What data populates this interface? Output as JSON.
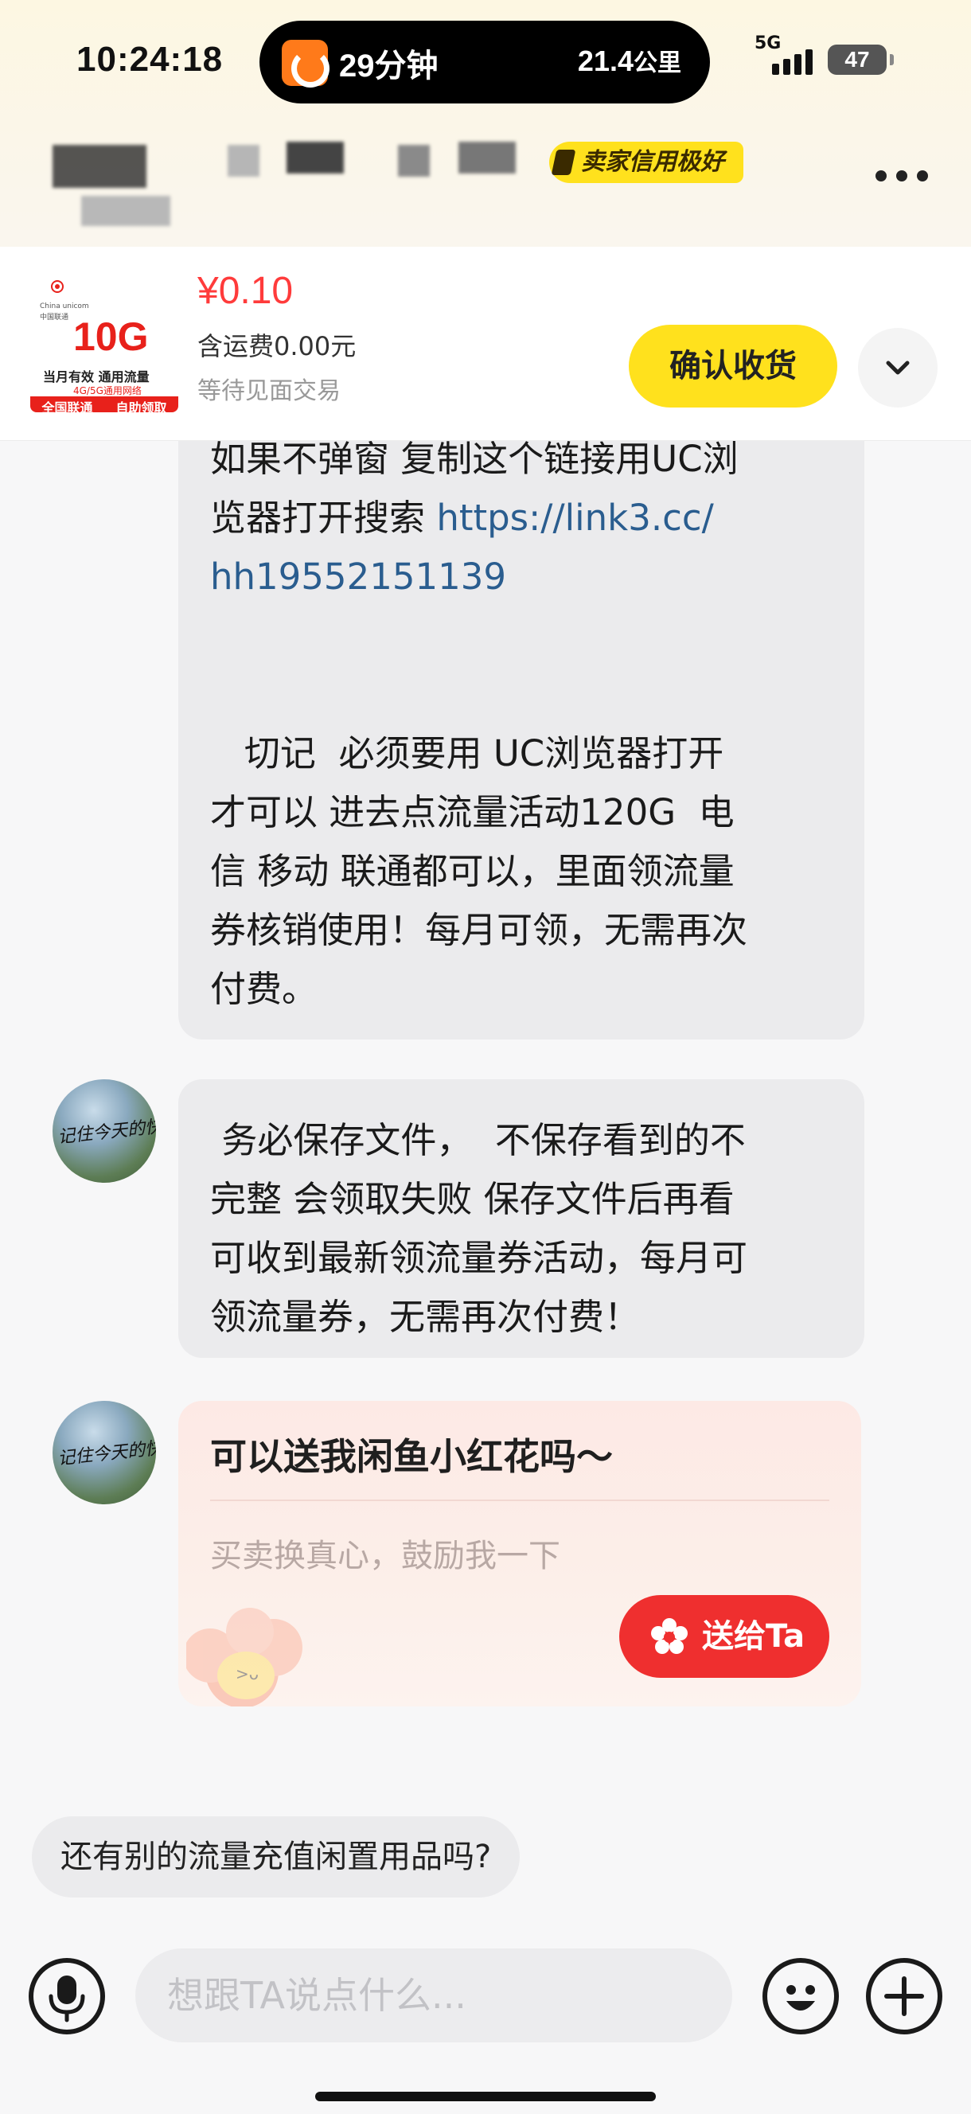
{
  "status_bar": {
    "time": "10:24:18",
    "island_time": "29分钟",
    "island_distance": "21.4",
    "island_distance_unit": "公里",
    "network": "5G",
    "battery": "47"
  },
  "header": {
    "seller_badge": "卖家信用极好",
    "more_icon": "more-dots-icon"
  },
  "product": {
    "thumb": {
      "brand": "China unicom中国联通",
      "capacity": "10G",
      "line1": "当月有效  通用流量",
      "line2": "4G/5G通用网络",
      "bottom_left": "全国联通",
      "bottom_right": "自助领取"
    },
    "price": "¥0.10",
    "shipping": "含运费0.00元",
    "status": "等待见面交易",
    "confirm_label": "确认收货",
    "expand_icon": "chevron-down-icon"
  },
  "messages": [
    {
      "text_prefix": "如果不弹窗 复制这个链接用UC浏\n览器打开搜索 ",
      "link_part1": "https://link3.cc/",
      "link_part2": "hh19552151139",
      "text_suffix": "\n\n\n   切记  必须要用 UC浏览器打开\n才可以 进去点流量活动120G  电\n信 移动 联通都可以，里面领流量\n券核销使用！每月可领，无需再次\n付费。"
    },
    {
      "text": " 务必保存文件，  不保存看到的不\n完整 会领取失败 保存文件后再看\n可收到最新领流量券活动，每月可\n领流量券，无需再次付费！",
      "avatar_text": "记住今天的快"
    }
  ],
  "flower_card": {
    "title": "可以送我闲鱼小红花吗～",
    "subtitle": "买卖换真心，鼓励我一下",
    "button_label": "送给Ta",
    "avatar_text": "记住今天的快"
  },
  "suggestion": "还有别的流量充值闲置用品吗?",
  "input_bar": {
    "placeholder": "想跟TA说点什么...",
    "voice_icon": "microphone-icon",
    "emoji_icon": "emoji-icon",
    "plus_icon": "plus-icon"
  },
  "colors": {
    "accent_yellow": "#ffe11d",
    "price_red": "#ff3b3b",
    "button_red": "#ef2f2f",
    "link_blue": "#2a5d8f"
  }
}
